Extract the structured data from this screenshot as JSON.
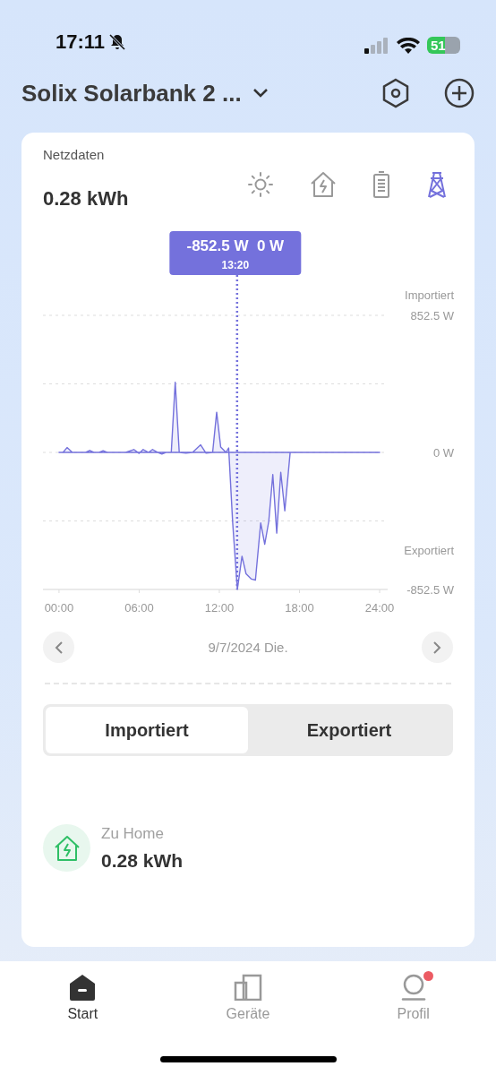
{
  "status_bar": {
    "time": "17:11",
    "silent": true,
    "battery": "51"
  },
  "header": {
    "title": "Solix Solarbank 2 ..."
  },
  "card": {
    "title": "Netzdaten",
    "total": "0.28 kWh",
    "metric_tabs": [
      {
        "kind": "solar",
        "selected": false
      },
      {
        "kind": "home",
        "selected": false
      },
      {
        "kind": "battery",
        "selected": false
      },
      {
        "kind": "grid",
        "selected": true
      }
    ],
    "chart": {
      "side_labels": {
        "top": "Importiert",
        "bottom": "Exportiert"
      },
      "tooltip": {
        "values": [
          "-852.5 W",
          "0 W"
        ]
      },
      "chart_data": {
        "type": "area",
        "x": [
          0,
          0.3,
          0.6,
          1,
          2,
          2.3,
          2.6,
          3,
          3.3,
          3.6,
          4,
          5,
          5.6,
          6,
          6.3,
          6.7,
          7,
          7.4,
          7.7,
          8,
          8.4,
          8.7,
          9,
          9.5,
          10,
          10.6,
          11,
          11.5,
          11.8,
          12.1,
          12.5,
          12.7,
          13,
          13.35,
          13.7,
          14,
          14.4,
          14.7,
          15.1,
          15.4,
          15.7,
          16,
          16.3,
          16.6,
          16.9,
          17.3,
          18,
          20,
          22,
          24
        ],
        "values": [
          0,
          0,
          30,
          0,
          0,
          12,
          0,
          0,
          10,
          0,
          0,
          0,
          18,
          -6,
          18,
          0,
          18,
          0,
          -10,
          0,
          0,
          437,
          0,
          -5,
          0,
          47,
          -5,
          0,
          250,
          33,
          0,
          28,
          -439,
          -852.5,
          -646,
          -755,
          -788,
          -794,
          -439,
          -571,
          -429,
          -138,
          -502,
          -124,
          -364,
          0,
          0,
          0,
          0,
          0
        ],
        "xlim": [
          -1.2,
          24.6
        ],
        "ylim": [
          -852.5,
          852.5
        ],
        "xticks": [
          {
            "value": 0,
            "label": "00:00"
          },
          {
            "value": 6,
            "label": "06:00"
          },
          {
            "value": 12,
            "label": "12:00"
          },
          {
            "value": 18,
            "label": "18:00"
          },
          {
            "value": 24,
            "label": "24:00"
          }
        ],
        "yticks": [
          {
            "value": 852.5,
            "label": "852.5 W"
          },
          {
            "value": 0,
            "label": "0 W"
          },
          {
            "value": -852.5,
            "label": "-852.5 W"
          }
        ],
        "annotations": [
          {
            "x": 13.33,
            "text": "13:20"
          }
        ]
      }
    },
    "date": "9/7/2024 Die.",
    "segments": [
      {
        "label": "Importiert",
        "selected": true
      },
      {
        "label": "Exportiert",
        "selected": false
      }
    ],
    "entry": {
      "label": "Zu Home",
      "value": "0.28 kWh"
    }
  },
  "nav": [
    {
      "kind": "start",
      "label": "Start",
      "selected": true,
      "badge": false
    },
    {
      "kind": "devices",
      "label": "Geräte",
      "selected": false,
      "badge": false
    },
    {
      "kind": "profile",
      "label": "Profil",
      "selected": false,
      "badge": true
    }
  ]
}
